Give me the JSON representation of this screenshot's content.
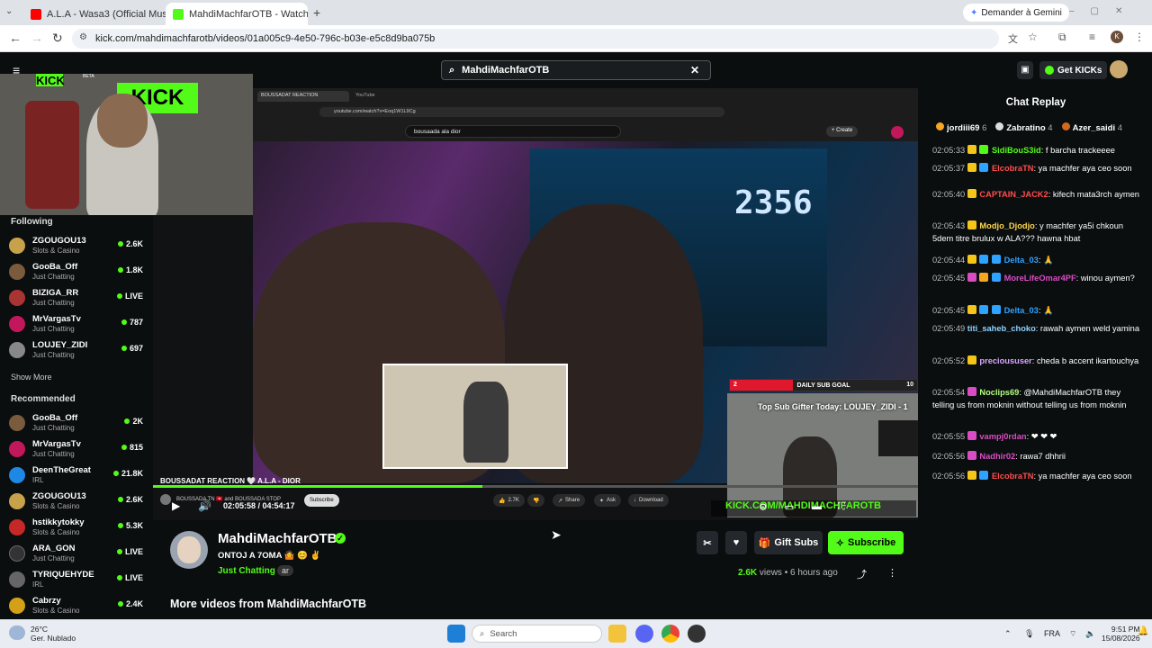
{
  "browser": {
    "tabs": [
      {
        "title": "A.L.A - Wasa3 (Official Music Vi",
        "active": false
      },
      {
        "title": "MahdiMachfarOTB - Watch the",
        "active": true
      }
    ],
    "new_tab": "+",
    "url": "kick.com/mahdimachfarotb/videos/01a005c9-4e50-796c-b03e-e5c8d9ba075b",
    "gemini_button": "Demander à Gemini",
    "profile_initial": "K"
  },
  "kick": {
    "logo": "KICK",
    "logo_badge": "BETA",
    "search_value": "MahdiMachfarOTB",
    "get_kicks": "Get KICKs"
  },
  "sidebar": {
    "following_title": "Following",
    "following": [
      {
        "name": "ZGOUGOU13",
        "category": "Slots & Casino",
        "viewers": "2.6K",
        "color": "#c8a24a"
      },
      {
        "name": "GooBa_Off",
        "category": "Just Chatting",
        "viewers": "1.8K",
        "color": "#7a5b3d"
      },
      {
        "name": "BIZIGA_RR",
        "category": "Just Chatting",
        "viewers": "LIVE",
        "color": "#a33"
      },
      {
        "name": "MrVargasTv",
        "category": "Just Chatting",
        "viewers": "787",
        "color": "#c2185b"
      },
      {
        "name": "LOUJEY_ZIDI",
        "category": "Just Chatting",
        "viewers": "697",
        "color": "#888"
      }
    ],
    "show_more": "Show More",
    "recommended_title": "Recommended",
    "recommended": [
      {
        "name": "GooBa_Off",
        "category": "Just Chatting",
        "viewers": "2K",
        "color": "#7a5b3d"
      },
      {
        "name": "MrVargasTv",
        "category": "Just Chatting",
        "viewers": "815",
        "color": "#c2185b"
      },
      {
        "name": "DeenTheGreat",
        "category": "IRL",
        "viewers": "21.8K",
        "color": "#1e88e5"
      },
      {
        "name": "ZGOUGOU13",
        "category": "Slots & Casino",
        "viewers": "2.6K",
        "color": "#c8a24a"
      },
      {
        "name": "hstikkytokky",
        "category": "Slots & Casino",
        "viewers": "5.3K",
        "color": "#c62828"
      },
      {
        "name": "ARA_GON",
        "category": "Just Chatting",
        "viewers": "LIVE",
        "color": "#333"
      },
      {
        "name": "TYRIQUEHYDE",
        "category": "IRL",
        "viewers": "LIVE",
        "color": "#666"
      },
      {
        "name": "Cabrzy",
        "category": "Slots & Casino",
        "viewers": "2.4K",
        "color": "#d4a017"
      }
    ]
  },
  "embedded_youtube": {
    "tab1": "BOUSSADAT REACTION",
    "tab2": "YouTube",
    "url": "youtube.com/watch?v=Eoq1W1L9Cg",
    "search": "bousaada ala dior",
    "create": "Create",
    "video_title": "BOUSSADAT REACTION 🤍 A.L.A - DIOR",
    "channel": "BOUSSADA TN 🇹🇳 and BOUSSADA STOP",
    "subscribe": "Subscribe",
    "likes": "2.7K",
    "share": "Share",
    "ask": "Ask",
    "download": "Download",
    "daily_sub_goal": "DAILY SUB GOAL",
    "goal_current": "2",
    "goal_target": "10",
    "top_gifter": "Top Sub Gifter Today: LOUJEY_ZIDI - 1",
    "big_number": "2356",
    "overlay_url": "KICK.COM/MAHDIMACHFAROTB"
  },
  "player": {
    "time": "02:05:58 / 04:54:17",
    "progress": 0.43
  },
  "video_info": {
    "channel_name": "MahdiMachfarOTB",
    "title": "ONTOJ A 7OMA 🤷 😊 ✌",
    "category": "Just Chatting",
    "tag": "ar",
    "gift_subs": "Gift Subs",
    "subscribe": "Subscribe",
    "views_count": "2.6K",
    "views_label": "views",
    "age": "6 hours ago",
    "more_videos": "More videos from MahdiMachfarOTB"
  },
  "chat": {
    "title": "Chat Replay",
    "top_gifters": [
      {
        "name": "jordiii69",
        "count": "6",
        "color": "#f5a623"
      },
      {
        "name": "Zabratino",
        "count": "4",
        "color": "#ddd"
      },
      {
        "name": "Azer_saidi",
        "count": "4",
        "color": "#d2691e"
      }
    ],
    "messages": [
      {
        "time": "02:05:33",
        "user": "SidiBouS3id",
        "user_color": "#53fc18",
        "text": "f barcha trackeeee",
        "badges": [
          "#f5c518",
          "#53fc18"
        ]
      },
      {
        "time": "02:05:37",
        "user": "ElcobraTN",
        "user_color": "#ff4d4d",
        "text": "ya machfer aya ceo soon",
        "badges": [
          "#f5c518",
          "#2ea3ff"
        ]
      },
      {
        "time": "02:05:40",
        "user": "CAPTAIN_JACK2",
        "user_color": "#ff4d4d",
        "text": "kifech mata3rch aymen",
        "badges": [
          "#f5c518"
        ]
      },
      {
        "time": "02:05:43",
        "user": "Modjo_Djodjo",
        "user_color": "#ffd84d",
        "text": "y machfer ya5i chkoun 5dem titre brulux w ALA??? hawna hbat",
        "badges": [
          "#f5c518"
        ]
      },
      {
        "time": "02:05:44",
        "user": "Delta_03",
        "user_color": "#2ea3ff",
        "text": "🙏",
        "badges": [
          "#f5c518",
          "#2ea3ff",
          "#2ea3ff"
        ]
      },
      {
        "time": "02:05:45",
        "user": "MoreLifeOmar4PF",
        "user_color": "#d94cc4",
        "text": "winou aymen?",
        "badges": [
          "#d94cc4",
          "#f5a623",
          "#2ea3ff"
        ]
      },
      {
        "time": "02:05:45",
        "user": "Delta_03",
        "user_color": "#2ea3ff",
        "text": "🙏",
        "badges": [
          "#f5c518",
          "#2ea3ff",
          "#2ea3ff"
        ]
      },
      {
        "time": "02:05:49",
        "user": "titi_saheb_choko",
        "user_color": "#8fd3ff",
        "text": "rawah aymen weld yamina",
        "badges": []
      },
      {
        "time": "02:05:52",
        "user": "precioususer",
        "user_color": "#d9a6ff",
        "text": "cheda b accent ikartouchya",
        "badges": [
          "#f5c518"
        ]
      },
      {
        "time": "02:05:54",
        "user": "Noclips69",
        "user_color": "#b3ff80",
        "text": "@MahdiMachfarOTB they telling us from moknin without telling us from moknin",
        "badges": [
          "#d94cc4"
        ]
      },
      {
        "time": "02:05:55",
        "user": "vampj0rdan",
        "user_color": "#d94cc4",
        "text": "❤ ❤ ❤",
        "badges": [
          "#d94cc4"
        ]
      },
      {
        "time": "02:05:56",
        "user": "Nadhir02",
        "user_color": "#d94cc4",
        "text": "rawa7 dhhrii",
        "badges": [
          "#d94cc4"
        ]
      },
      {
        "time": "02:05:56",
        "user": "ElcobraTN",
        "user_color": "#ff4d4d",
        "text": "ya machfer aya ceo soon",
        "badges": [
          "#f5c518",
          "#2ea3ff"
        ]
      }
    ]
  },
  "taskbar": {
    "temperature": "26°C",
    "weather": "Ger. Nublado",
    "search_placeholder": "Search",
    "lang": "FRA",
    "time": "9:51 PM",
    "date": "15/08/2026"
  }
}
